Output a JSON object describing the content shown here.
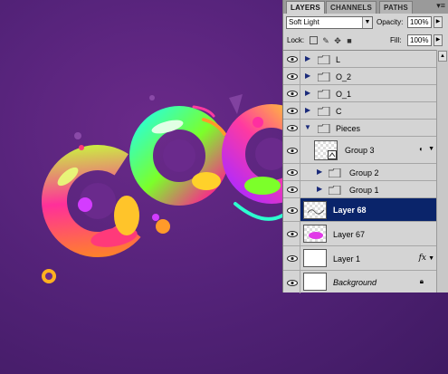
{
  "panel": {
    "tabs": [
      "LAYERS",
      "CHANNELS",
      "PATHS"
    ],
    "menu_icon": "panel-menu-icon",
    "blend_mode": "Soft Light",
    "opacity_label": "Opacity:",
    "opacity_value": "100%",
    "lock_label": "Lock:",
    "fill_label": "Fill:",
    "fill_value": "100%"
  },
  "layers": [
    {
      "name": "L",
      "type": "group",
      "expanded": false,
      "indent": 0
    },
    {
      "name": "O_2",
      "type": "group",
      "expanded": false,
      "indent": 0
    },
    {
      "name": "O_1",
      "type": "group",
      "expanded": false,
      "indent": 0
    },
    {
      "name": "C",
      "type": "group",
      "expanded": false,
      "indent": 0
    },
    {
      "name": "Pieces",
      "type": "group",
      "expanded": true,
      "indent": 0
    },
    {
      "name": "Group 3",
      "type": "smart",
      "indent": 1
    },
    {
      "name": "Group 2",
      "type": "group",
      "expanded": false,
      "indent": 1
    },
    {
      "name": "Group 1",
      "type": "group",
      "expanded": false,
      "indent": 1
    },
    {
      "name": "Layer 68",
      "type": "layer",
      "selected": true
    },
    {
      "name": "Layer 67",
      "type": "layer"
    },
    {
      "name": "Layer 1",
      "type": "layer",
      "fx": "fx"
    },
    {
      "name": "Background",
      "type": "background"
    }
  ],
  "colors": {
    "canvas_bg": "#55237a",
    "selection": "#0a246a",
    "panel_bg": "#d4d4d4"
  }
}
